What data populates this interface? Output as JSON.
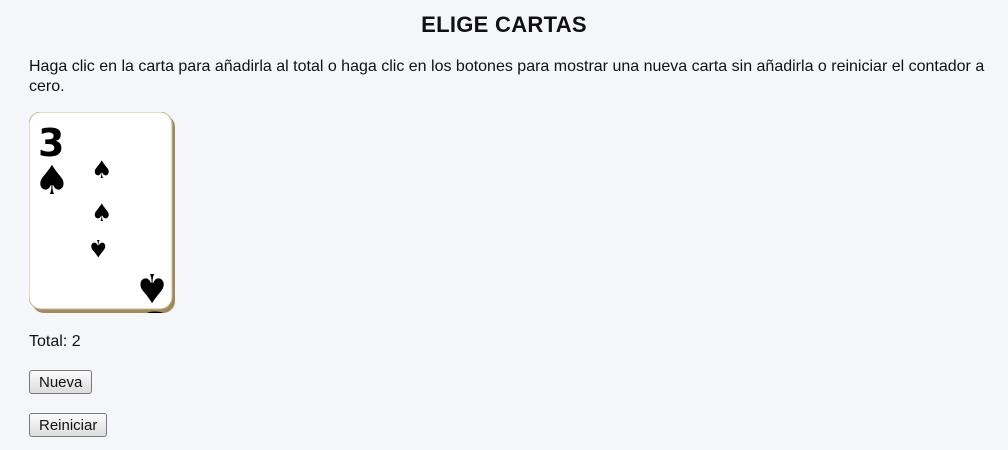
{
  "page": {
    "title": "ELIGE CARTAS",
    "instructions": "Haga clic en la carta para añadirla al total o haga clic en los botones para mostrar una nueva carta sin añadirla o reiniciar el contador a cero."
  },
  "card": {
    "rank": "3",
    "suit": "spades",
    "suit_symbol": "♠"
  },
  "total": {
    "label": "Total:",
    "value": "2"
  },
  "buttons": {
    "new_label": "Nueva",
    "reset_label": "Reiniciar"
  }
}
